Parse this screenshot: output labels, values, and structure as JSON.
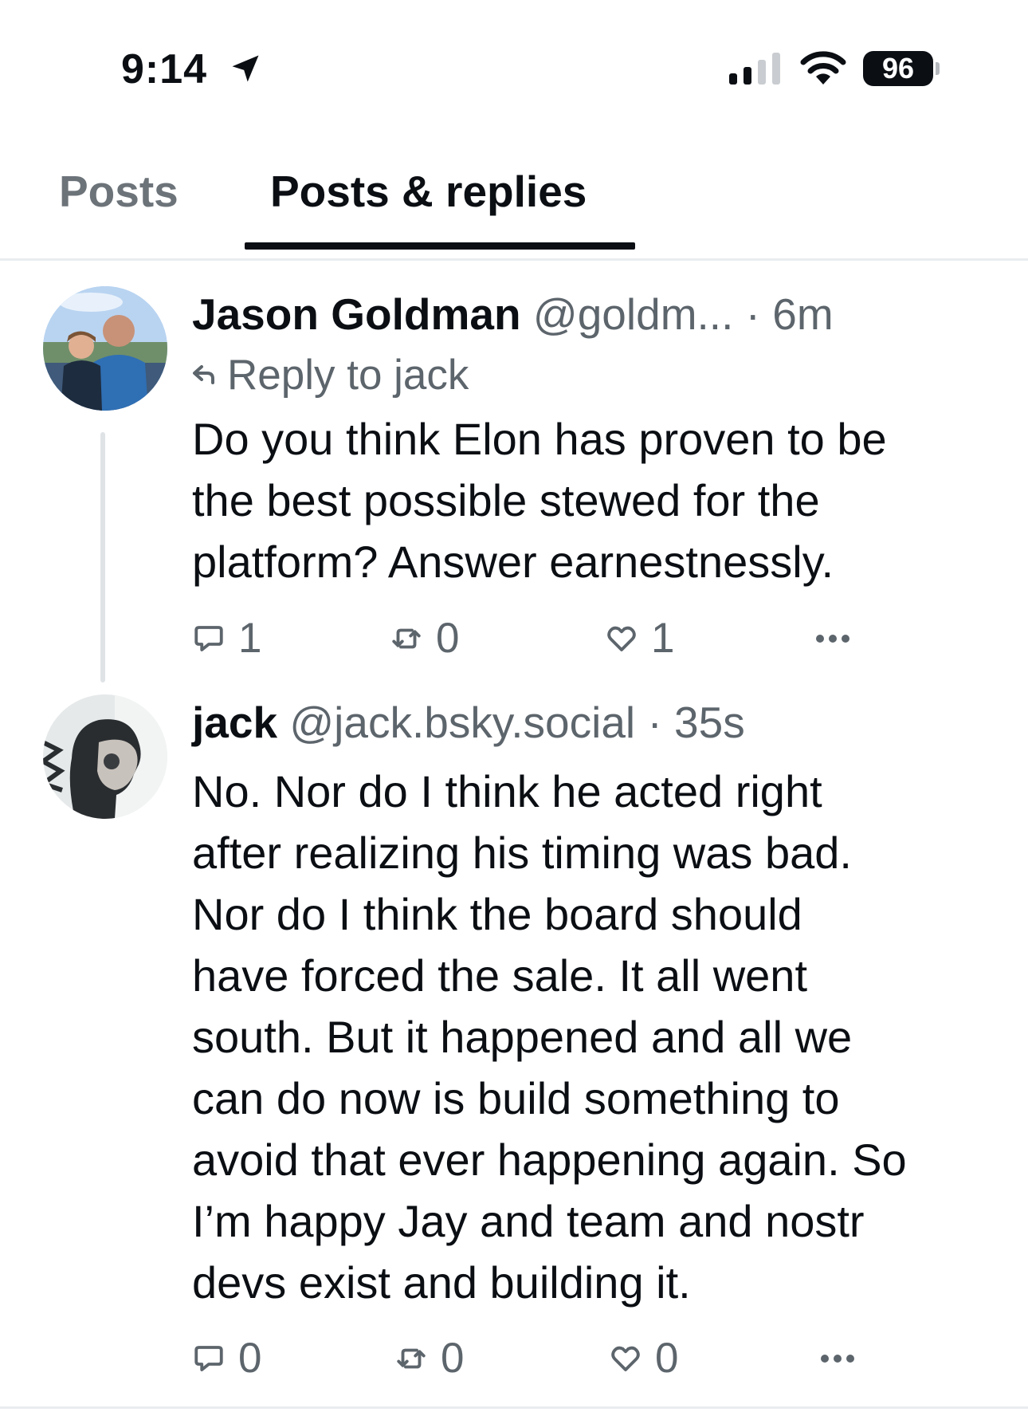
{
  "status_bar": {
    "time": "9:14",
    "battery": "96"
  },
  "tabs": [
    {
      "label": "Posts",
      "active": false
    },
    {
      "label": "Posts & replies",
      "active": true
    }
  ],
  "posts": [
    {
      "author": "Jason Goldman",
      "handle": "@goldm...",
      "separator": "·",
      "time": "6m",
      "reply_to": "Reply to jack",
      "text": "Do you think Elon has proven to be\nthe best possible stewed for the\nplatform? Answer earnestnessly.",
      "replies": "1",
      "reposts": "0",
      "likes": "1"
    },
    {
      "author": "jack",
      "handle": "@jack.bsky.social",
      "separator": "·",
      "time": "35s",
      "text": "No. Nor do I think he acted right\nafter realizing his timing was bad.\nNor do I think the board should\nhave forced the sale. It all went\nsouth. But it happened and all we\ncan do now is build something to\navoid that ever happening again. So\nI’m happy Jay and team and nostr\ndevs exist and building it.",
      "replies": "0",
      "reposts": "0",
      "likes": "0"
    }
  ]
}
